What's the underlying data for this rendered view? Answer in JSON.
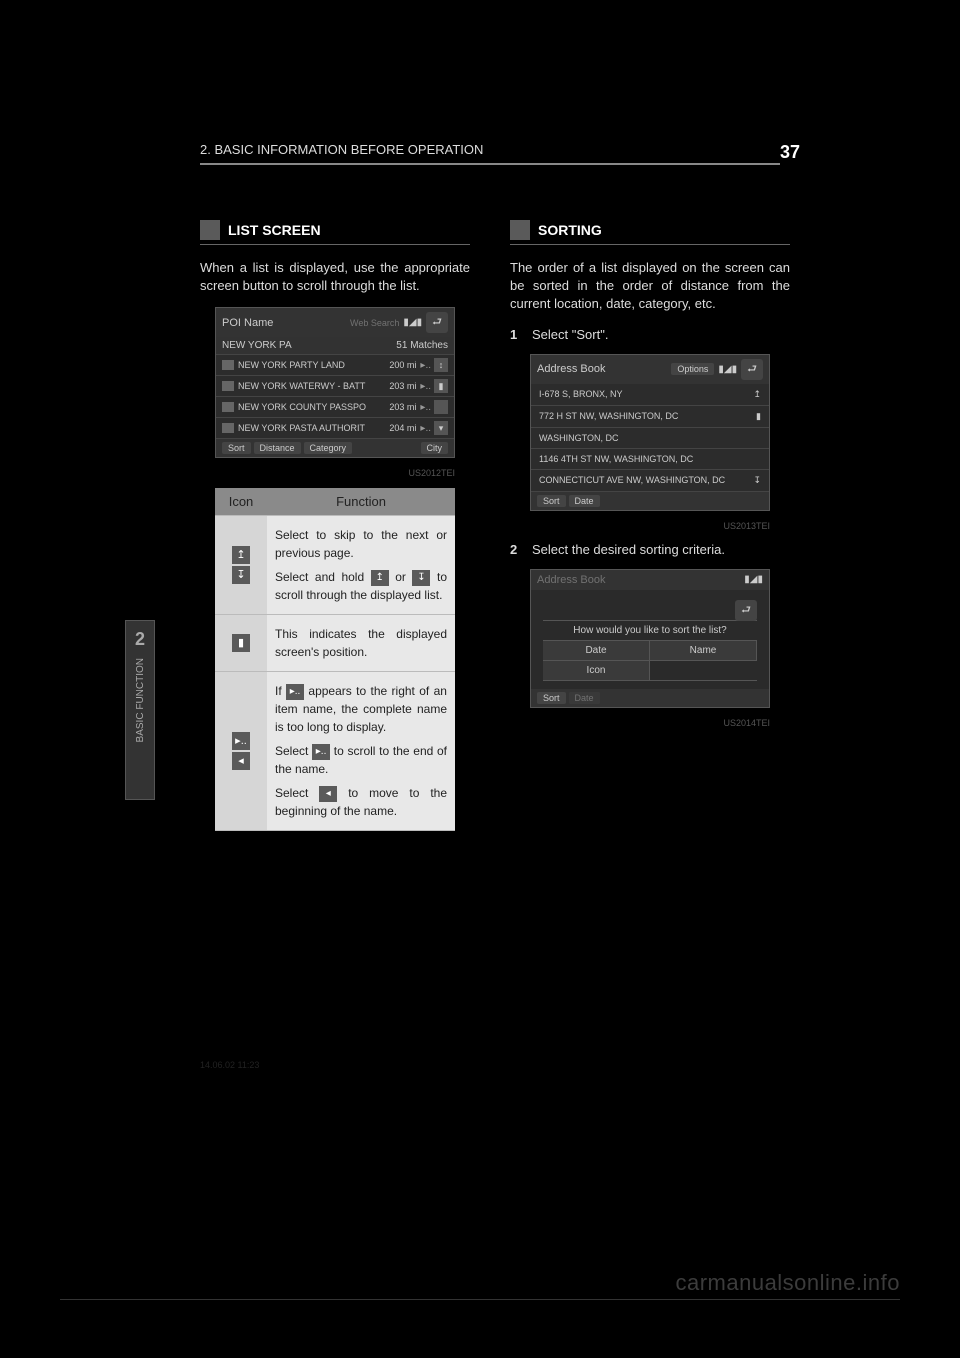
{
  "page": {
    "section_label": "2. BASIC INFORMATION BEFORE OPERATION",
    "page_number": "37",
    "side_tab_number": "2",
    "side_tab_label": "BASIC FUNCTION",
    "watermark": "carmanualsonline.info",
    "footer_code": "14.06.02     11:23"
  },
  "left": {
    "header": "LIST SCREEN",
    "intro": "When a list is displayed, use the appropriate screen button to scroll through the list.",
    "shot": {
      "title": "POI Name",
      "websearch": "Web Search",
      "back_icon": "⮐",
      "query": "NEW YORK PA",
      "matches": "51 Matches",
      "rows": [
        {
          "name": "NEW YORK PARTY LAND",
          "dist": "200 mi",
          "scroll": "↕"
        },
        {
          "name": "NEW YORK WATERWY - BATT",
          "dist": "203 mi",
          "scroll": "▮"
        },
        {
          "name": "NEW YORK COUNTY PASSPO",
          "dist": "203 mi",
          "scroll": ""
        },
        {
          "name": "NEW YORK PASTA AUTHORIT",
          "dist": "204 mi",
          "scroll": "▾"
        }
      ],
      "footer": {
        "sort": "Sort",
        "distance": "Distance",
        "category": "Category",
        "city": "City"
      },
      "shot_id": "US2012TEI"
    },
    "legend": {
      "col_icon": "Icon",
      "col_func": "Function",
      "rows": {
        "row1": {
          "up": "↥",
          "dn": "↧",
          "text_a": "Select to skip to the next or previous page.",
          "text_b1": "Select and hold ",
          "text_b2": " or ",
          "text_b3": " to scroll through the displayed list."
        },
        "row2": {
          "pos": "▮",
          "text": "This indicates the displayed screen's position."
        },
        "row3": {
          "more": "▸..",
          "back": "◂",
          "text_a1": "If ",
          "text_a2": " appears to the right of an item name, the complete name is too long to display.",
          "text_b1": "Select ",
          "text_b2": " to scroll to the end of the name.",
          "text_c1": "Select ",
          "text_c2": " to move to the beginning of the name."
        }
      }
    }
  },
  "right": {
    "header": "SORTING",
    "intro": "The order of a list displayed on the screen can be sorted in the order of distance from the current location, date, category, etc.",
    "step1": "Select \"Sort\".",
    "step2": "Select the desired sorting criteria.",
    "shot1": {
      "title": "Address Book",
      "options": "Options",
      "back_icon": "⮐",
      "rows": [
        "I-678 S, BRONX, NY",
        "772 H ST NW, WASHINGTON, DC",
        "WASHINGTON, DC",
        "1146 4TH ST NW, WASHINGTON, DC",
        "CONNECTICUT AVE NW, WASHINGTON, DC"
      ],
      "footer": {
        "sort": "Sort",
        "date": "Date"
      },
      "shot_id": "US2013TEI"
    },
    "shot2": {
      "title": "Address Book",
      "back_icon": "⮐",
      "question": "How would you like to sort the list?",
      "btn_date": "Date",
      "btn_name": "Name",
      "btn_icon": "Icon",
      "footer": {
        "sort": "Sort",
        "date": "Date"
      },
      "shot_id": "US2014TEI"
    }
  }
}
